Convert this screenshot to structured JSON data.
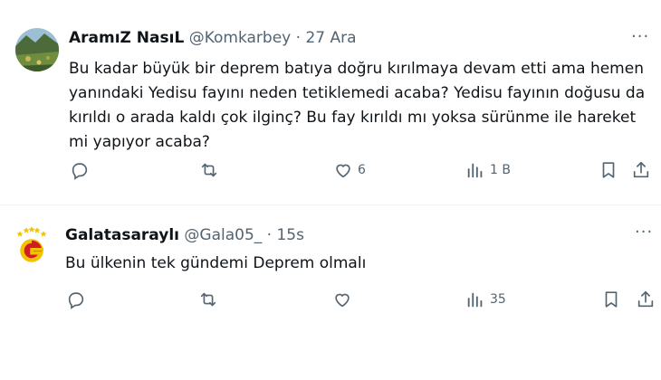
{
  "tweets": [
    {
      "author_name": "AramıZ NasıL",
      "handle": "@Komkarbey",
      "separator": "·",
      "time": "27 Ara",
      "more": "···",
      "text": "Bu kadar büyük bir deprem batıya doğru kırılmaya devam etti ama hemen yanındaki Yedisu fayını neden tetiklemedi acaba? Yedisu fayının doğusu da kırıldı o arada kaldı çok ilginç? Bu fay kırıldı mı yoksa sürünme ile hareket mi yapıyor acaba?",
      "likes": "6",
      "views": "1 B"
    },
    {
      "author_name": "Galatasaraylı",
      "handle": "@Gala05_",
      "separator": "·",
      "time": "15s",
      "more": "···",
      "text": "Bu ülkenin tek gündemi Deprem olmalı",
      "likes": "",
      "views": "35"
    }
  ],
  "colors": {
    "text": "#0f1419",
    "muted": "#536471",
    "divider": "#eff3f4",
    "gs_yellow": "#f2c200",
    "gs_red": "#d21c23"
  },
  "icons": [
    "reply-icon",
    "retweet-icon",
    "like-icon",
    "views-icon",
    "bookmark-icon",
    "share-icon"
  ]
}
